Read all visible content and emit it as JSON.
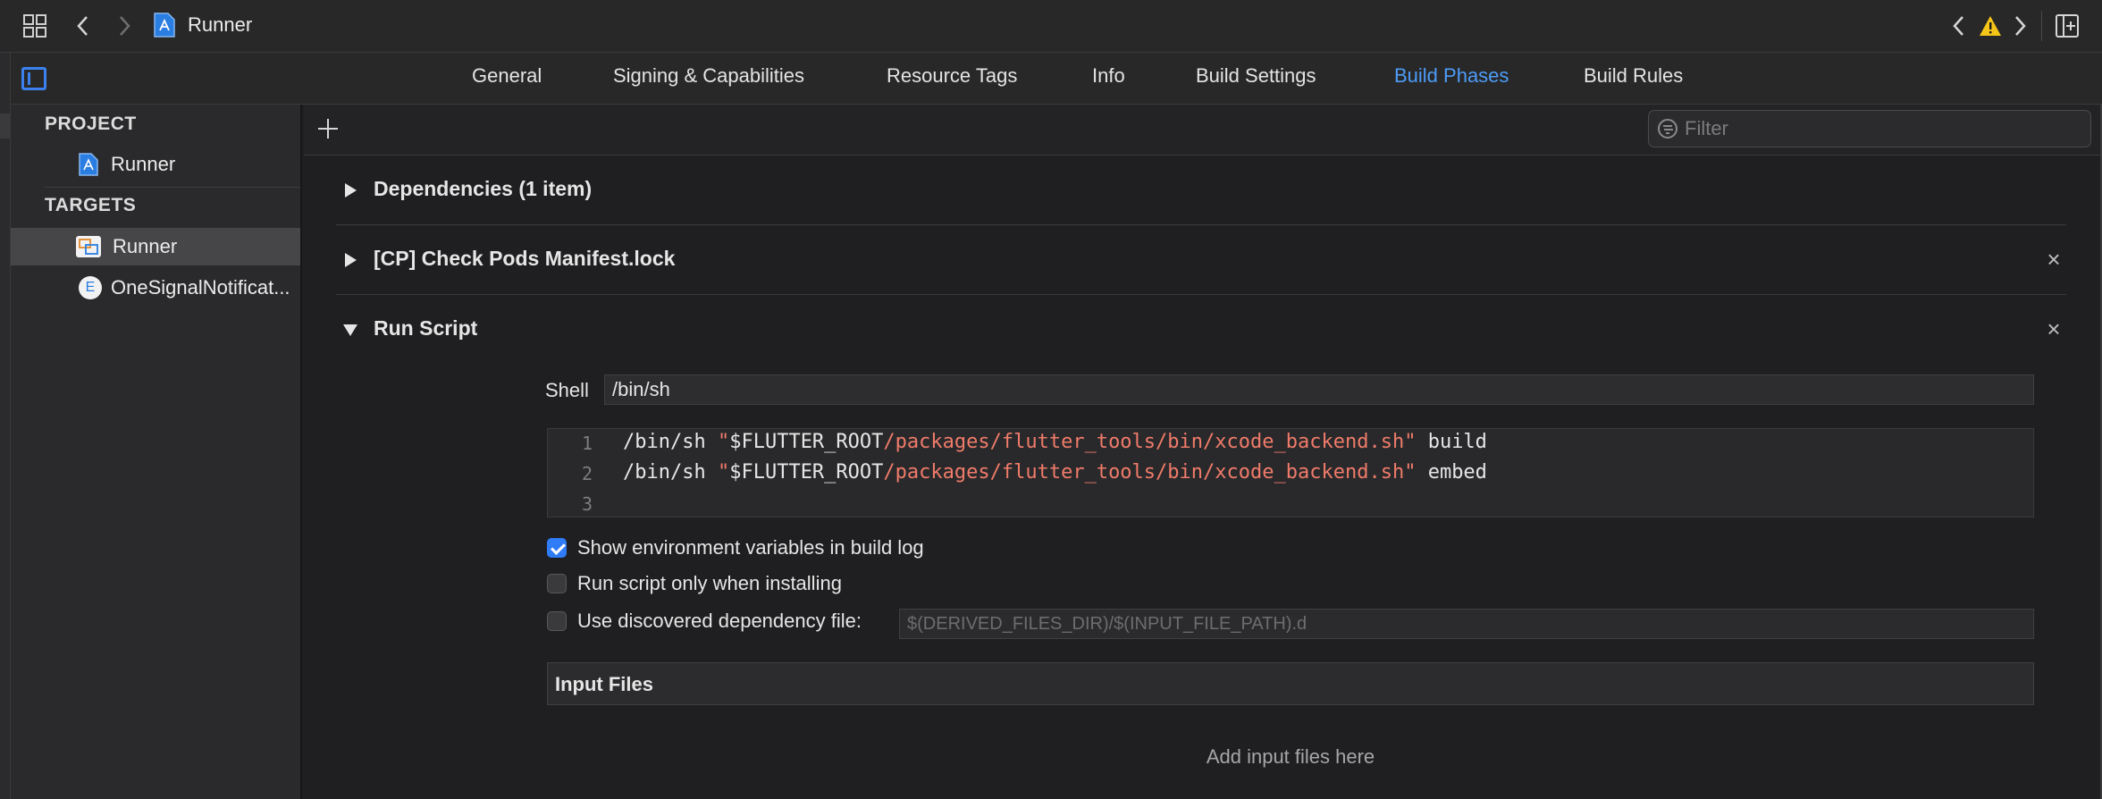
{
  "toolbar": {
    "title": "Runner",
    "warning_symbol": "⚠",
    "icons": [
      "grid-icon",
      "back-icon",
      "forward-icon",
      "xcode-project-icon",
      "prev-issue-icon",
      "warning-icon",
      "next-issue-icon",
      "add-editor-icon"
    ]
  },
  "tabs": [
    {
      "label": "General",
      "active": false
    },
    {
      "label": "Signing & Capabilities",
      "active": false
    },
    {
      "label": "Resource Tags",
      "active": false
    },
    {
      "label": "Info",
      "active": false
    },
    {
      "label": "Build Settings",
      "active": false
    },
    {
      "label": "Build Phases",
      "active": true
    },
    {
      "label": "Build Rules",
      "active": false
    }
  ],
  "sidebar": {
    "project_header": "PROJECT",
    "project_item": "Runner",
    "targets_header": "TARGETS",
    "targets": [
      {
        "label": "Runner",
        "selected": true
      },
      {
        "label": "OneSignalNotificationServiceExtension",
        "display": "OneSignalNotificat...",
        "badge": "E",
        "selected": false
      }
    ]
  },
  "filter": {
    "placeholder": "Filter"
  },
  "phases": [
    {
      "title": "Dependencies (1 item)",
      "expanded": false,
      "deletable": false
    },
    {
      "title": "[CP] Check Pods Manifest.lock",
      "expanded": false,
      "deletable": true
    },
    {
      "title": "Run Script",
      "expanded": true,
      "deletable": true
    }
  ],
  "close_symbol": "×",
  "run_script": {
    "shell_label": "Shell",
    "shell_value": "/bin/sh",
    "lines": [
      {
        "n": "1",
        "cmd": "/bin/sh ",
        "q1": "\"",
        "var": "$FLUTTER_ROOT",
        "path": "/packages/flutter_tools/bin/xcode_backend.sh",
        "q2": "\"",
        "arg": " build"
      },
      {
        "n": "2",
        "cmd": "/bin/sh ",
        "q1": "\"",
        "var": "$FLUTTER_ROOT",
        "path": "/packages/flutter_tools/bin/xcode_backend.sh",
        "q2": "\"",
        "arg": " embed"
      },
      {
        "n": "3",
        "cmd": "",
        "q1": "",
        "var": "",
        "path": "",
        "q2": "",
        "arg": ""
      }
    ],
    "options": [
      {
        "label": "Show environment variables in build log",
        "checked": true
      },
      {
        "label": "Run script only when installing",
        "checked": false
      },
      {
        "label": "Use discovered dependency file:",
        "checked": false
      }
    ],
    "dependency_placeholder": "$(DERIVED_FILES_DIR)/$(INPUT_FILE_PATH).d",
    "input_files_label": "Input Files",
    "input_files_hint": "Add input files here"
  },
  "colors": {
    "accent": "#4d9cf8",
    "string": "#f07b6a",
    "warning": "#f5c518",
    "background": "#1f1f21"
  }
}
